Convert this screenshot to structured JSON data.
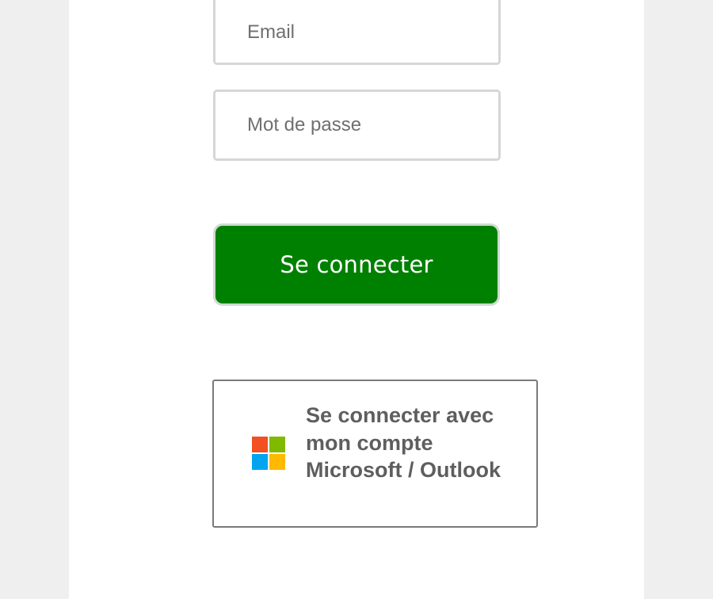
{
  "login_form": {
    "email_placeholder": "Email",
    "email_value": "",
    "password_placeholder": "Mot de passe",
    "password_value": "",
    "submit_label": "Se connecter"
  },
  "microsoft_login": {
    "label": "Se connecter avec mon compte Microsoft / Outlook",
    "icon": "microsoft-logo-icon",
    "logo_colors": [
      "#f25022",
      "#7fba00",
      "#00a4ef",
      "#ffb900"
    ]
  },
  "colors": {
    "page_background": "#efefef",
    "panel_background": "#ffffff",
    "primary_button": "#008000",
    "field_border": "#d6d6d6",
    "ms_button_border": "#7a7a7a",
    "ms_button_text": "#5e5e5e"
  }
}
